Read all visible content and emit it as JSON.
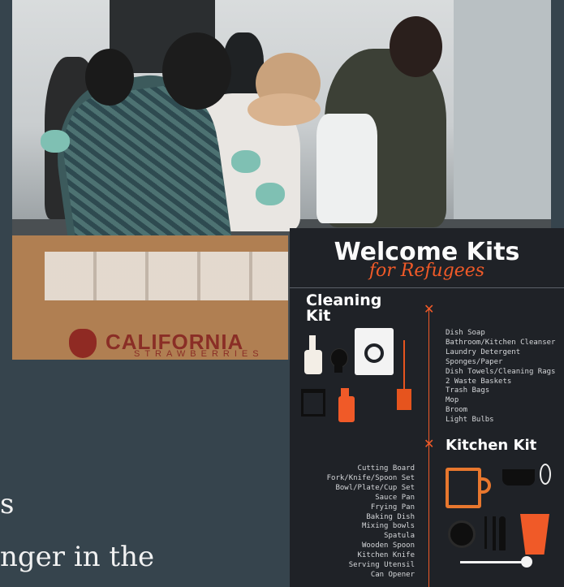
{
  "photo": {
    "box_label": "CALIFORNIA",
    "box_label2": "STRAWBERRIES"
  },
  "slide": {
    "line1": "s",
    "line2": "nger in the"
  },
  "infographic": {
    "title": "Welcome Kits",
    "subtitle": "for Refugees",
    "accent_color": "#f05a28",
    "cleaning": {
      "heading_line1": "Cleaning",
      "heading_line2": "Kit",
      "items": [
        "Dish Soap",
        "Bathroom/Kitchen Cleanser",
        "Laundry Detergent",
        "Sponges/Paper",
        "Dish Towels/Cleaning Rags",
        "2 Waste Baskets",
        "Trash Bags",
        "Mop",
        "Broom",
        "Light Bulbs"
      ]
    },
    "kitchen": {
      "heading": "Kitchen Kit",
      "items": [
        "Cutting Board",
        "Fork/Knife/Spoon Set",
        "Bowl/Plate/Cup Set",
        "Sauce Pan",
        "Frying Pan",
        "Baking Dish",
        "Mixing bowls",
        "Spatula",
        "Wooden Spoon",
        "Kitchen Knife",
        "Serving Utensil",
        "Can Opener"
      ]
    }
  }
}
